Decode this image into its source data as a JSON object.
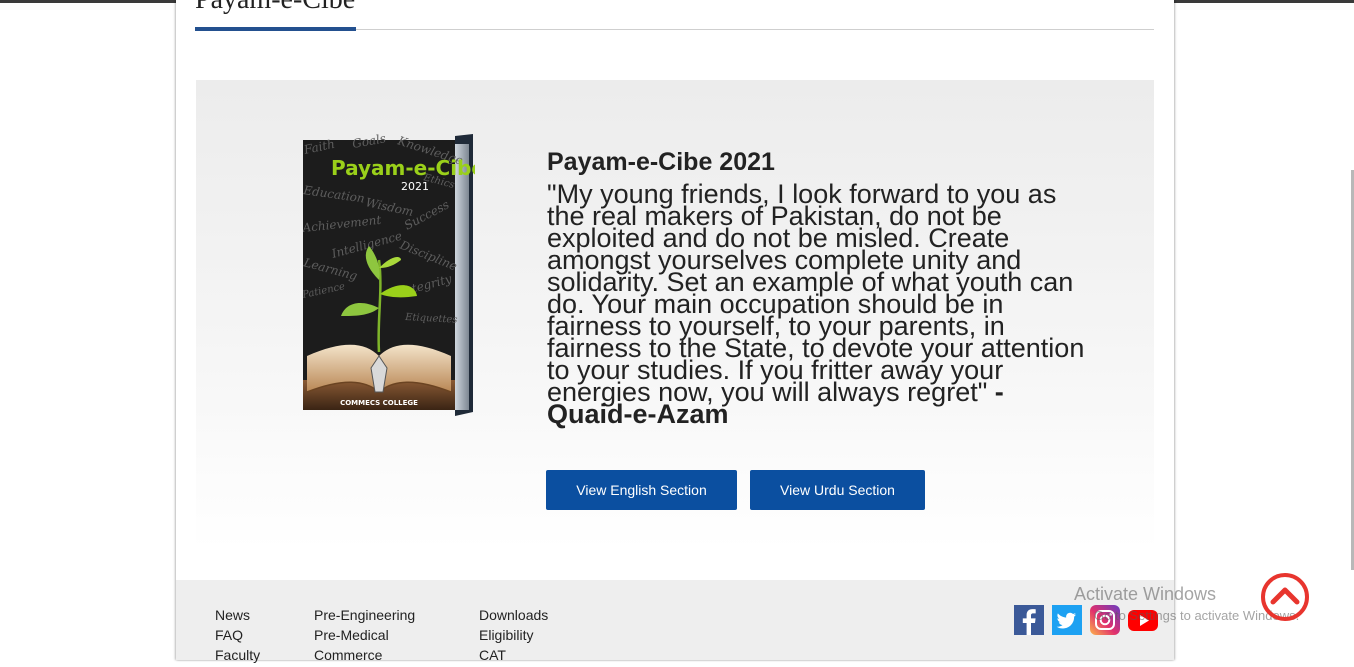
{
  "section_title": "Payam-e-Cibe",
  "book_cover": {
    "title": "Payam-e-Cibe",
    "year": "2021",
    "publisher": "COMMECS COLLEGE",
    "words": [
      "Faith",
      "Goals",
      "Knowledge",
      "Ethics",
      "Education",
      "Wisdom",
      "Success",
      "Achievement",
      "Intelligence",
      "Discipline",
      "Learning",
      "Integrity",
      "Patience",
      "Etiquettes"
    ]
  },
  "heading": "Payam-e-Cibe 2021",
  "quote": {
    "text": "\"My young friends, I look forward to you as the real makers of Pakistan, do not be exploited and do not be misled. Create amongst yourselves complete unity and solidarity. Set an example of what youth can do. Your main occupation should be in fairness to yourself, to your parents, in fairness to the State, to devote your attention to your studies. If you fritter away your energies now, you will always regret\"",
    "author": " - Quaid-e-Azam"
  },
  "buttons": {
    "english": "View English Section",
    "urdu": "View Urdu Section"
  },
  "footer": {
    "col1": [
      "News",
      "FAQ",
      "Faculty"
    ],
    "col2": [
      "Pre-Engineering",
      "Pre-Medical",
      "Commerce"
    ],
    "col3": [
      "Downloads",
      "Eligibility",
      "CAT"
    ]
  },
  "social": [
    "facebook-icon",
    "twitter-icon",
    "instagram-icon",
    "youtube-icon"
  ],
  "watermark": {
    "line1": "Activate Windows",
    "line2": "Go to Settings to activate Windows."
  },
  "colors": {
    "accent": "#23508f",
    "button": "#0b4fa0",
    "footer_bg": "#eeeeee",
    "scroll_top": "#e8352e"
  }
}
